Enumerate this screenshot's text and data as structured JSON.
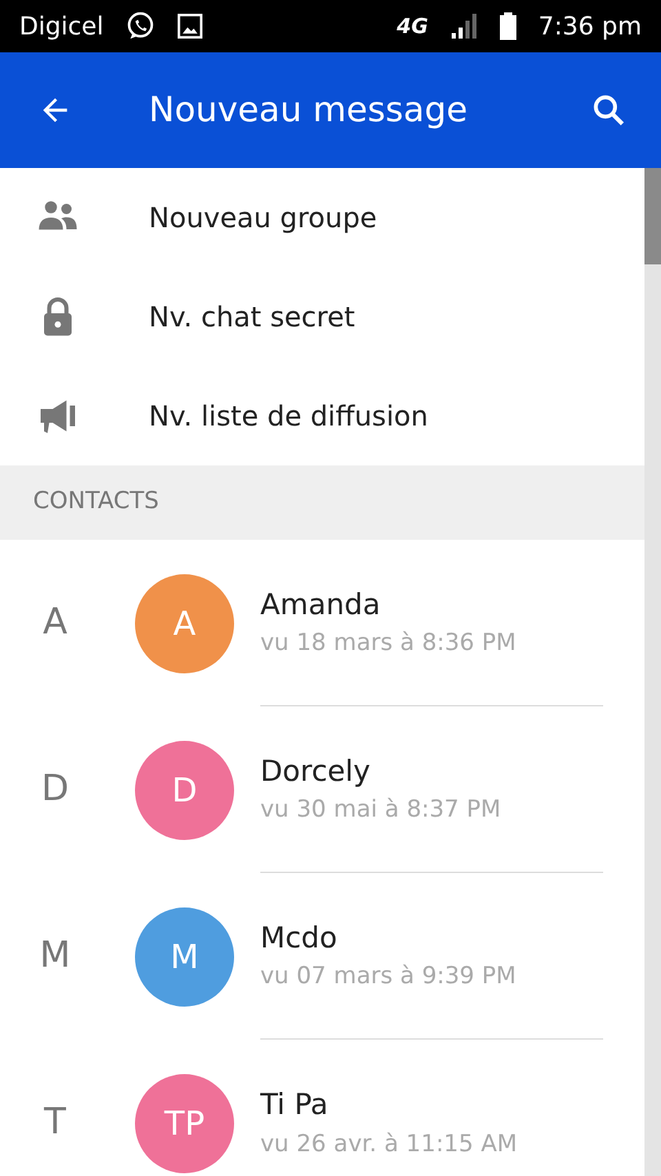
{
  "status_bar": {
    "carrier": "Digicel",
    "network": "4G",
    "time": "7:36 pm"
  },
  "app_bar": {
    "title": "Nouveau message"
  },
  "actions": [
    {
      "kind": "group",
      "label": "Nouveau groupe"
    },
    {
      "kind": "lock",
      "label": "Nv. chat secret"
    },
    {
      "kind": "megaphone",
      "label": "Nv. liste de diffusion"
    }
  ],
  "section": {
    "title": "CONTACTS"
  },
  "contacts": [
    {
      "index_letter": "A",
      "initials": "A",
      "color": "#f0914a",
      "name": "Amanda",
      "last_seen": "vu 18 mars à 8:36 PM"
    },
    {
      "index_letter": "D",
      "initials": "D",
      "color": "#ef7198",
      "name": "Dorcely",
      "last_seen": "vu 30 mai à 8:37 PM"
    },
    {
      "index_letter": "M",
      "initials": "M",
      "color": "#4f9ddf",
      "name": "Mcdo",
      "last_seen": "vu 07 mars à 9:39 PM"
    },
    {
      "index_letter": "T",
      "initials": "TP",
      "color": "#ef7198",
      "name": "Ti Pa",
      "last_seen": "vu 26 avr. à 11:15 AM"
    }
  ]
}
